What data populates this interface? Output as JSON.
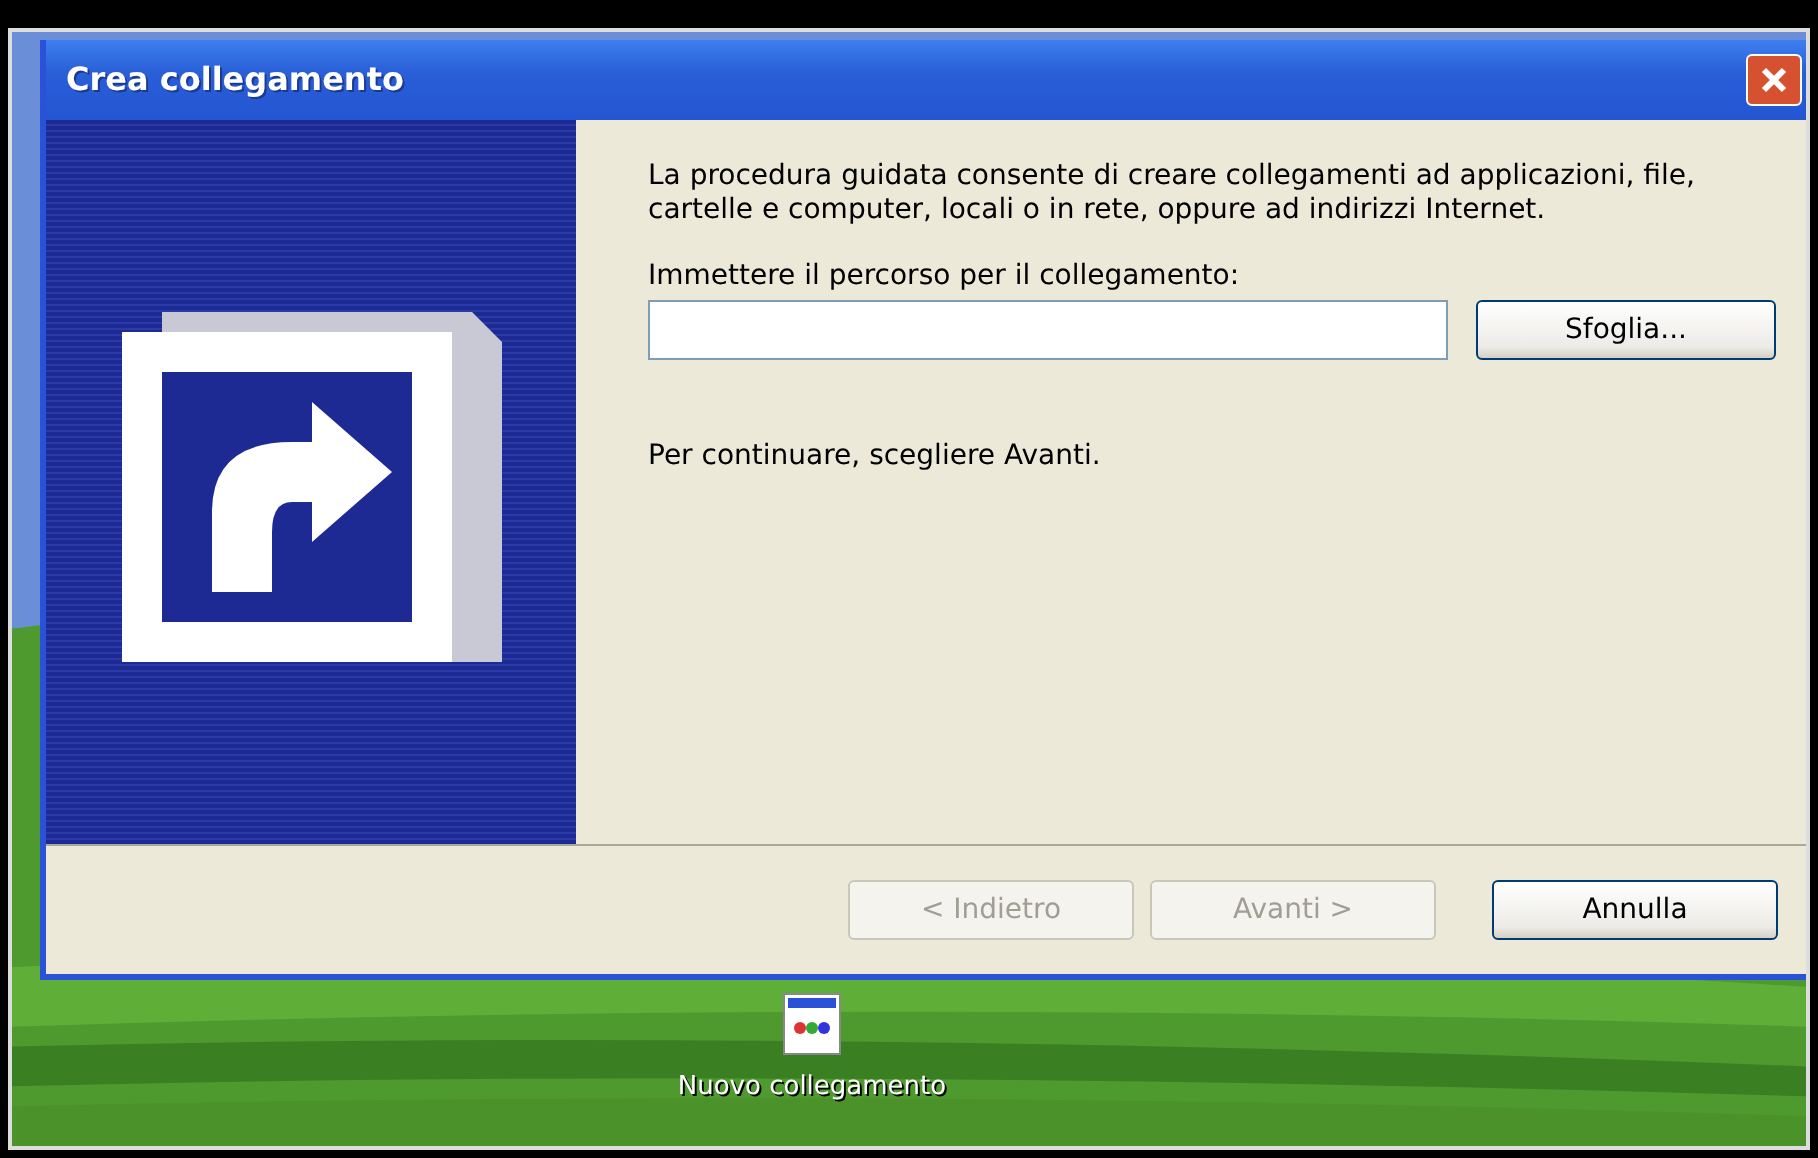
{
  "window": {
    "title": "Crea collegamento"
  },
  "intro": "La procedura guidata consente di creare collegamenti ad applicazioni, file, cartelle e computer, locali o in rete, oppure ad indirizzi Internet.",
  "path_field": {
    "label": "Immettere il percorso per il collegamento:"
  },
  "browse_button": "Sfoglia...",
  "hint": "Per continuare, scegliere Avanti.",
  "buttons": [
    {
      "label": "< Indietro",
      "disabled": true
    },
    {
      "label": "Avanti >",
      "disabled": true
    },
    {
      "label": "Annulla",
      "disabled": false
    }
  ],
  "desktop_icon": {
    "label": "Nuovo collegamento"
  }
}
